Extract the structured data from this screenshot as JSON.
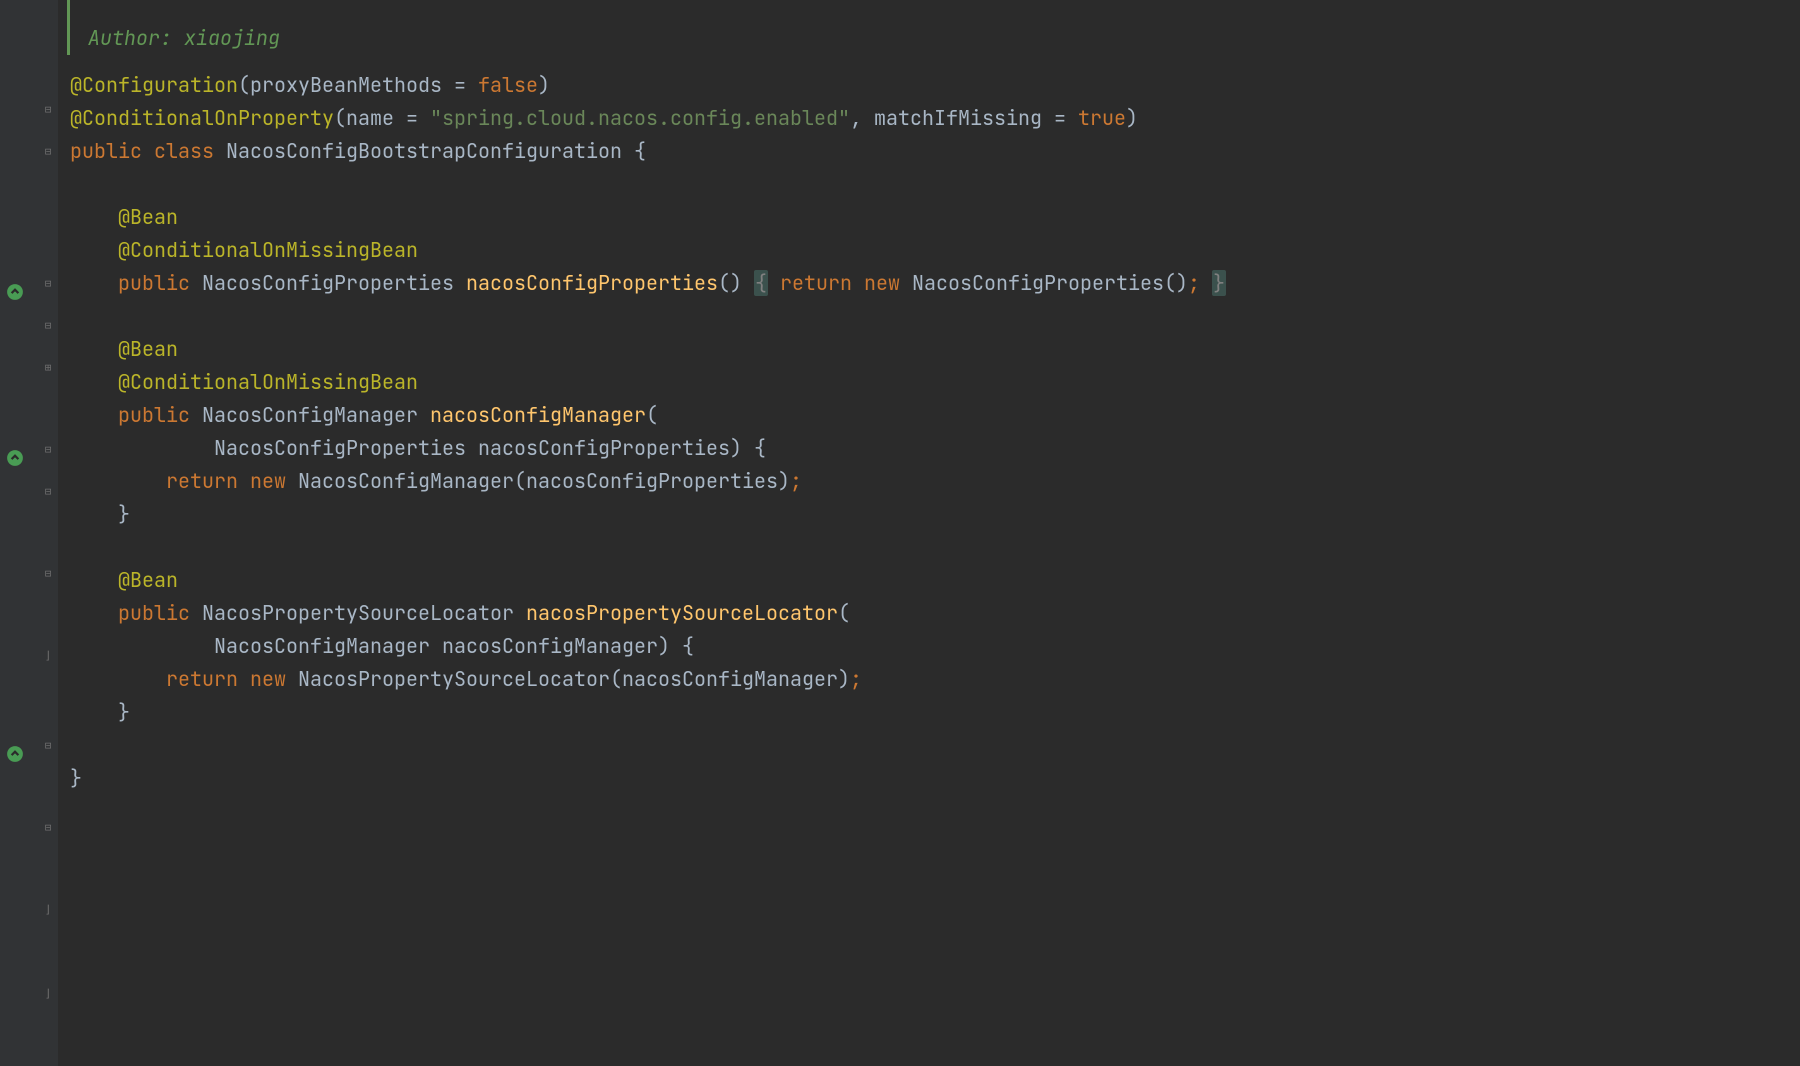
{
  "doc": {
    "author_label": "Author:",
    "author_name": "xiaojing"
  },
  "code": {
    "anno_configuration": "@Configuration",
    "proxy_param": "proxyBeanMethods = ",
    "false_kw": "false",
    "anno_cond_prop": "@ConditionalOnProperty",
    "name_param": "name = ",
    "spring_prop_str": "\"spring.cloud.nacos.config.enabled\"",
    "match_param": ", matchIfMissing = ",
    "true_kw": "true",
    "public_kw": "public",
    "class_kw": "class",
    "return_kw": "return",
    "new_kw": "new",
    "class_name": "NacosConfigBootstrapConfiguration",
    "anno_bean": "@Bean",
    "anno_cond_missing": "@ConditionalOnMissingBean",
    "type_ncp": "NacosConfigProperties",
    "meth_ncp": "nacosConfigProperties",
    "type_ncm": "NacosConfigManager",
    "meth_ncm": "nacosConfigManager",
    "param_ncp": "nacosConfigProperties",
    "type_npsl": "NacosPropertySourceLocator",
    "meth_npsl": "nacosPropertySourceLocator",
    "param_ncm": "nacosConfigManager"
  },
  "gutter": {
    "override_icon": "override-icon",
    "fold_minus": "⊟",
    "fold_plus": "⊞",
    "fold_end": "⌋"
  }
}
